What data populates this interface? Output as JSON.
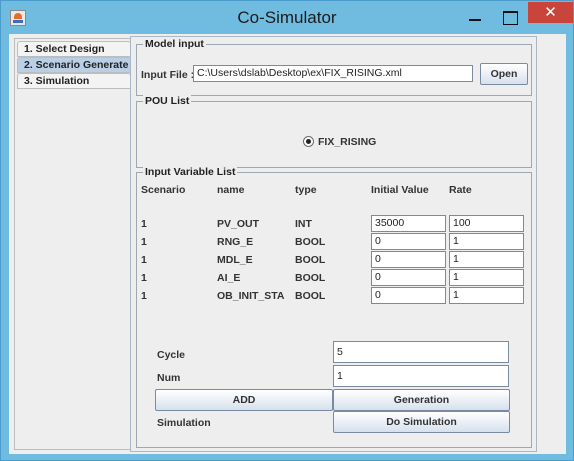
{
  "window": {
    "title": "Co-Simulator"
  },
  "tabs": [
    {
      "label": "1. Select Design",
      "active": false
    },
    {
      "label": "2. Scenario Generate",
      "active": true
    },
    {
      "label": "3. Simulation",
      "active": false
    }
  ],
  "model_input": {
    "title": "Model input",
    "input_file_label": "Input File :",
    "input_file_value": "C:\\Users\\dslab\\Desktop\\ex\\FIX_RISING.xml",
    "open_button": "Open"
  },
  "pou_list": {
    "title": "POU List",
    "selected": "FIX_RISING"
  },
  "input_variables": {
    "title": "Input Variable List",
    "headers": [
      "Scenario",
      "name",
      "type",
      "Initial Value",
      "Rate"
    ],
    "rows": [
      {
        "scenario": "1",
        "name": "PV_OUT",
        "type": "INT",
        "initial": "35000",
        "rate": "100"
      },
      {
        "scenario": "1",
        "name": "RNG_E",
        "type": "BOOL",
        "initial": "0",
        "rate": "1"
      },
      {
        "scenario": "1",
        "name": "MDL_E",
        "type": "BOOL",
        "initial": "0",
        "rate": "1"
      },
      {
        "scenario": "1",
        "name": "AI_E",
        "type": "BOOL",
        "initial": "0",
        "rate": "1"
      },
      {
        "scenario": "1",
        "name": "OB_INIT_STA",
        "type": "BOOL",
        "initial": "0",
        "rate": "1"
      }
    ],
    "cycle_label": "Cycle",
    "cycle_value": "5",
    "num_label": "Num",
    "num_value": "1",
    "add_button": "ADD",
    "generation_button": "Generation",
    "simulation_label": "Simulation",
    "do_simulation_button": "Do Simulation"
  }
}
